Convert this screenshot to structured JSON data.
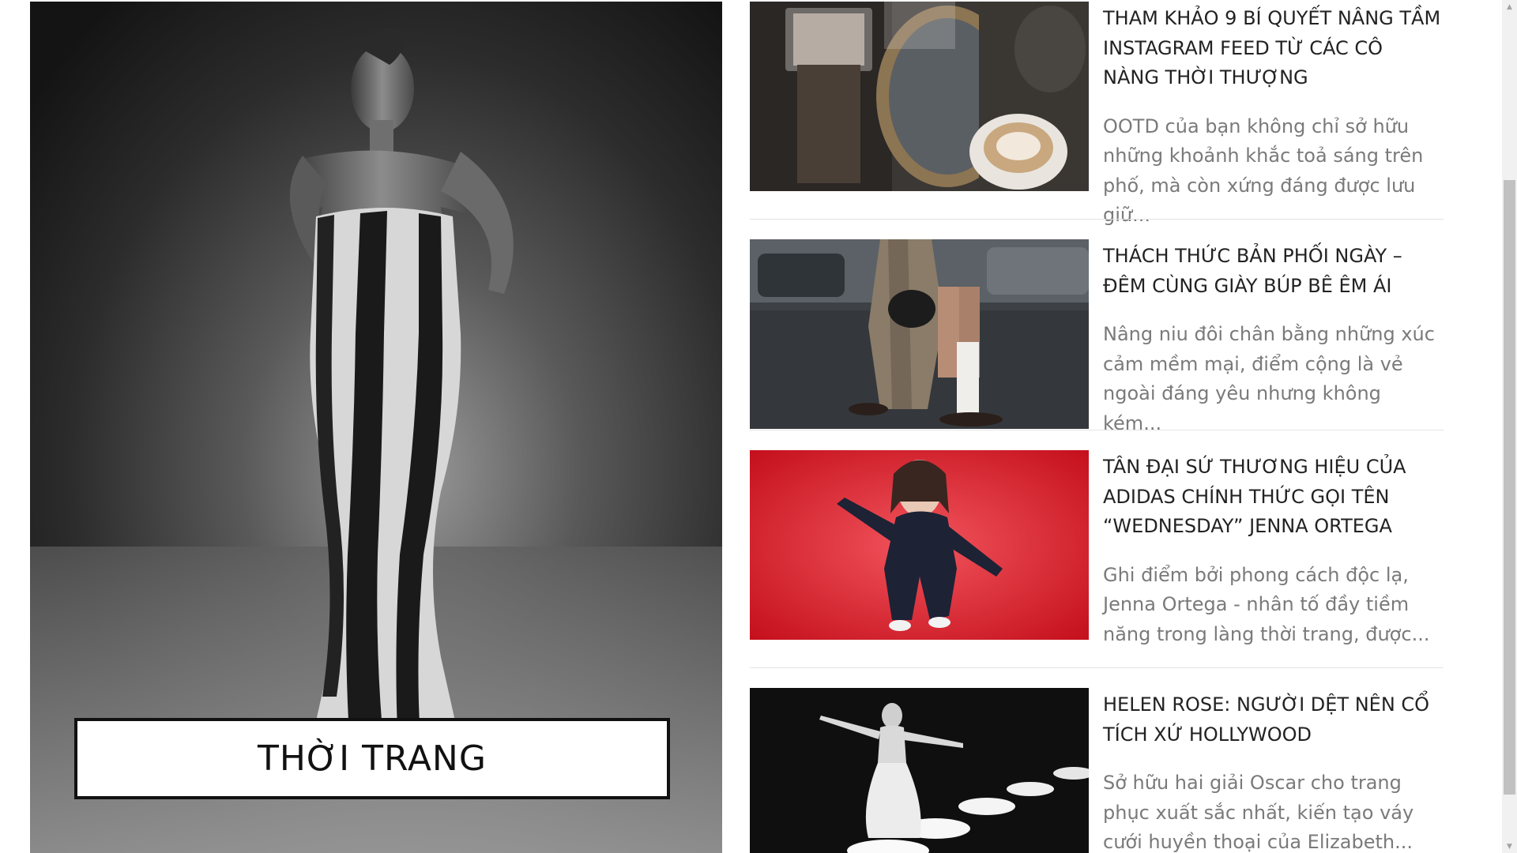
{
  "hero": {
    "category_label": "THỜI TRANG"
  },
  "articles": [
    {
      "title": "THAM KHẢO 9 BÍ QUYẾT NÂNG TẦM INSTAGRAM FEED TỪ CÁC CÔ NÀNG THỜI THƯỢNG",
      "excerpt": "OOTD của bạn không chỉ sở hữu những khoảnh khắc toả sáng trên phố, mà còn xứng đáng được lưu giữ..."
    },
    {
      "title": "THÁCH THỨC BẢN PHỐI NGÀY – ĐÊM CÙNG GIÀY BÚP BÊ ÊM ÁI",
      "excerpt": "Nâng niu đôi chân bằng những xúc cảm mềm mại, điểm cộng là vẻ ngoài đáng yêu nhưng không kém..."
    },
    {
      "title": "TÂN ĐẠI SỨ THƯƠNG HIỆU CỦA ADIDAS CHÍNH THỨC GỌI TÊN “WEDNESDAY” JENNA ORTEGA",
      "excerpt": "Ghi điểm bởi phong cách độc lạ, Jenna Ortega - nhân tố đầy tiềm năng trong làng thời trang, được..."
    },
    {
      "title": "HELEN ROSE: NGƯỜI DỆT NÊN CỔ TÍCH XỨ HOLLYWOOD",
      "excerpt": "Sở hữu hai giải Oscar cho trang phục xuất sắc nhất, kiến tạo váy cưới huyền thoại của Elizabeth..."
    }
  ],
  "scrollbar": {
    "up_arrow_icon": "triangle-up-icon",
    "down_arrow_icon": "triangle-down-icon"
  }
}
